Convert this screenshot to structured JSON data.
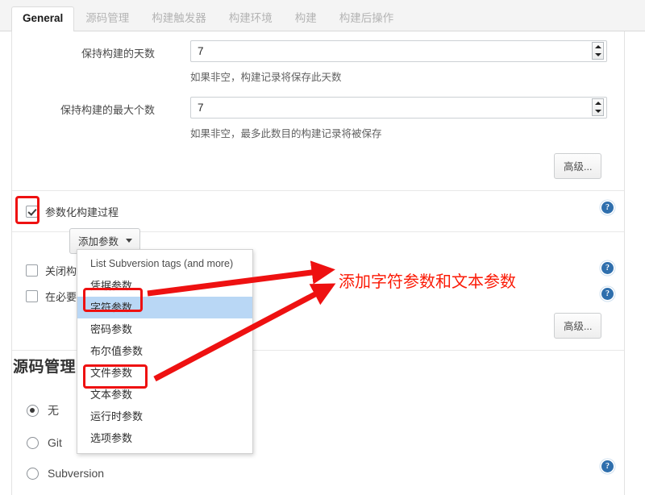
{
  "tabs": [
    {
      "label": "General",
      "active": true
    },
    {
      "label": "源码管理",
      "active": false
    },
    {
      "label": "构建触发器",
      "active": false
    },
    {
      "label": "构建环境",
      "active": false
    },
    {
      "label": "构建",
      "active": false
    },
    {
      "label": "构建后操作",
      "active": false
    }
  ],
  "form": {
    "days_to_keep": {
      "label": "保持构建的天数",
      "value": "7",
      "hint": "如果非空，构建记录将保存此天数"
    },
    "num_to_keep": {
      "label": "保持构建的最大个数",
      "value": "7",
      "hint": "如果非空，最多此数目的构建记录将被保存"
    },
    "advanced_button_1": "高级...",
    "advanced_button_2": "高级..."
  },
  "checkboxes": [
    {
      "label": "参数化构建过程",
      "checked": true
    },
    {
      "label": "关闭构",
      "checked": false
    },
    {
      "label": "在必要",
      "checked": false
    }
  ],
  "add_param": {
    "button_label": "添加参数",
    "menu_items": [
      {
        "label": "List Subversion tags (and more)",
        "highlighted": false
      },
      {
        "label": "凭据参数",
        "highlighted": false
      },
      {
        "label": "字符参数",
        "highlighted": true
      },
      {
        "label": "密码参数",
        "highlighted": false
      },
      {
        "label": "布尔值参数",
        "highlighted": false
      },
      {
        "label": "文件参数",
        "highlighted": false
      },
      {
        "label": "文本参数",
        "highlighted": false
      },
      {
        "label": "运行时参数",
        "highlighted": false
      },
      {
        "label": "选项参数",
        "highlighted": false
      }
    ]
  },
  "scm": {
    "title": "源码管理",
    "options": [
      {
        "label": "无",
        "selected": true
      },
      {
        "label": "Git",
        "selected": false
      },
      {
        "label": "Subversion",
        "selected": false
      }
    ]
  },
  "annotation": {
    "text": "添加字符参数和文本参数",
    "color": "#fb1a06"
  },
  "icons": {
    "help": "?"
  },
  "colors": {
    "highlight_row": "#b9d7f5",
    "annotation_red": "#ee1111",
    "help_blue": "#2f6fad"
  }
}
